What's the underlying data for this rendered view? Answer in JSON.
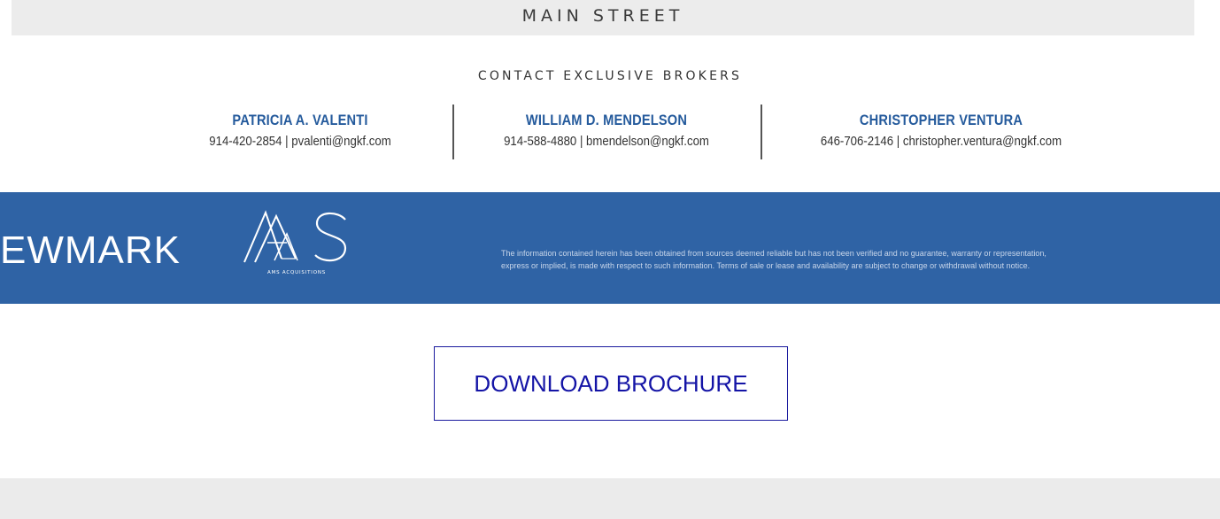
{
  "header": {
    "street": "MAIN STREET"
  },
  "contact": {
    "heading": "CONTACT EXCLUSIVE BROKERS",
    "brokers": [
      {
        "name": "PATRICIA A. VALENTI",
        "details": "914-420-2854 | pvalenti@ngkf.com"
      },
      {
        "name": "WILLIAM D. MENDELSON",
        "details": "914-588-4880 | bmendelson@ngkf.com"
      },
      {
        "name": "CHRISTOPHER VENTURA",
        "details": "646-706-2146 | christopher.ventura@ngkf.com"
      }
    ]
  },
  "footer_band": {
    "brand": "EWMARK",
    "logo_text": "AMS",
    "logo_caption": "AMS ACQUISITIONS",
    "disclaimer_line1": "The information contained herein has been obtained from sources deemed reliable but has not been verified and no guarantee, warranty or representation,",
    "disclaimer_line2": "express or implied, is made with respect to such information. Terms of sale or lease and availability are subject to change or withdrawal without notice."
  },
  "cta": {
    "download_label": "DOWNLOAD BROCHURE"
  },
  "colors": {
    "brand_blue": "#2f63a5",
    "broker_name": "#245a9c",
    "link_blue": "#1414a6",
    "banner_gray": "#ececec"
  }
}
